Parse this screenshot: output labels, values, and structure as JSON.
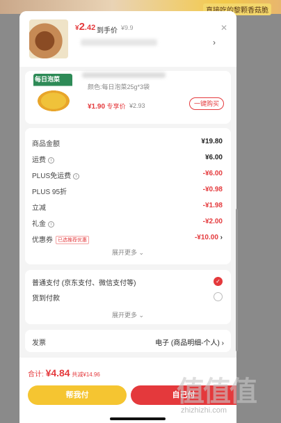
{
  "backdrop": {
    "top_text": "直接吃的黎颗香菇脆"
  },
  "header": {
    "currency": "¥",
    "price_int": "2",
    "price_dec": ".42",
    "price_label": "到手价",
    "original_price": "¥9.9"
  },
  "product": {
    "brand": "每日泡菜",
    "spec": "颜色:每日泡菜25g*3袋",
    "price": "¥1.90",
    "price_label": "专享价",
    "original_price": "¥2.93",
    "buy_label": "一键购买"
  },
  "fees": [
    {
      "label": "商品金额",
      "value": "¥19.80",
      "info": false,
      "color": "black"
    },
    {
      "label": "运费",
      "value": "¥6.00",
      "info": true,
      "color": "black"
    },
    {
      "label": "PLUS免运费",
      "value": "-¥6.00",
      "info": true,
      "color": "red"
    },
    {
      "label": "PLUS 95折",
      "value": "-¥0.98",
      "info": false,
      "color": "red"
    },
    {
      "label": "立减",
      "value": "-¥1.98",
      "info": false,
      "color": "red"
    },
    {
      "label": "礼金",
      "value": "-¥2.00",
      "info": true,
      "color": "red"
    },
    {
      "label": "优惠券",
      "value": "-¥10.00",
      "info": false,
      "color": "red",
      "badge": "已选推荐优惠"
    }
  ],
  "expand_label": "展开更多",
  "payment": {
    "options": [
      {
        "label": "普通支付 (京东支付、微信支付等)",
        "selected": true
      },
      {
        "label": "货到付款",
        "selected": false
      }
    ],
    "expand_label": "展开更多"
  },
  "invoice": {
    "label": "发票",
    "value": "电子 (商品明细-个人)"
  },
  "footer": {
    "total_label": "合计:",
    "total_amount": "¥4.84",
    "saved_label": "共减¥14.96",
    "help_pay_label": "帮我付",
    "self_pay_label": "自己付"
  },
  "watermark": {
    "logo": "值值值",
    "site": "zhizhizhi.com"
  },
  "colors": {
    "accent": "#e4393c",
    "help_pay": "#f5c531",
    "sheet_bg": "#f4f4f4"
  }
}
